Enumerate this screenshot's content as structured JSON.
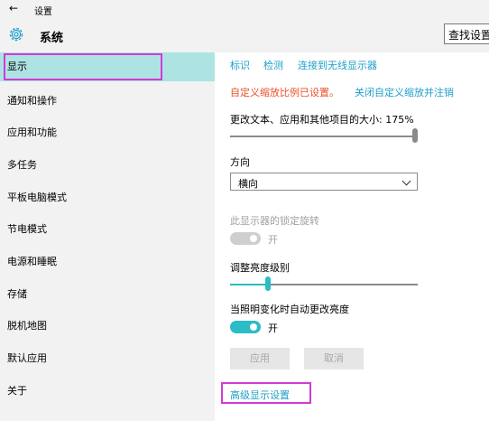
{
  "window": {
    "back_glyph": "←",
    "title": "设置"
  },
  "header": {
    "title": "系统",
    "search_placeholder": "查找设置"
  },
  "sidebar": {
    "items": [
      {
        "label": "显示"
      },
      {
        "label": "通知和操作"
      },
      {
        "label": "应用和功能"
      },
      {
        "label": "多任务"
      },
      {
        "label": "平板电脑模式"
      },
      {
        "label": "节电模式"
      },
      {
        "label": "电源和睡眠"
      },
      {
        "label": "存储"
      },
      {
        "label": "脱机地图"
      },
      {
        "label": "默认应用"
      },
      {
        "label": "关于"
      }
    ]
  },
  "display": {
    "links": {
      "identify": "标识",
      "detect": "检测",
      "wireless": "连接到无线显示器"
    },
    "custom_scale_notice": "自定义缩放比例已设置。",
    "disable_custom_scale": "关闭自定义缩放并注销",
    "scale_label": "更改文本、应用和其他项目的大小: 175%",
    "orientation_label": "方向",
    "orientation_value": "横向",
    "rotation_lock_label": "此显示器的锁定旋转",
    "rotation_lock_state": "开",
    "brightness_label": "调整亮度级别",
    "brightness_level": 0.2,
    "auto_brightness_label": "当照明变化时自动更改亮度",
    "auto_brightness_state": "开",
    "apply_button": "应用",
    "cancel_button": "取消",
    "advanced_link": "高级显示设置"
  },
  "colors": {
    "accent": "#2bbcc4",
    "link": "#1f9fc9",
    "warning": "#e8502a",
    "annotation": "#d23ad6"
  }
}
